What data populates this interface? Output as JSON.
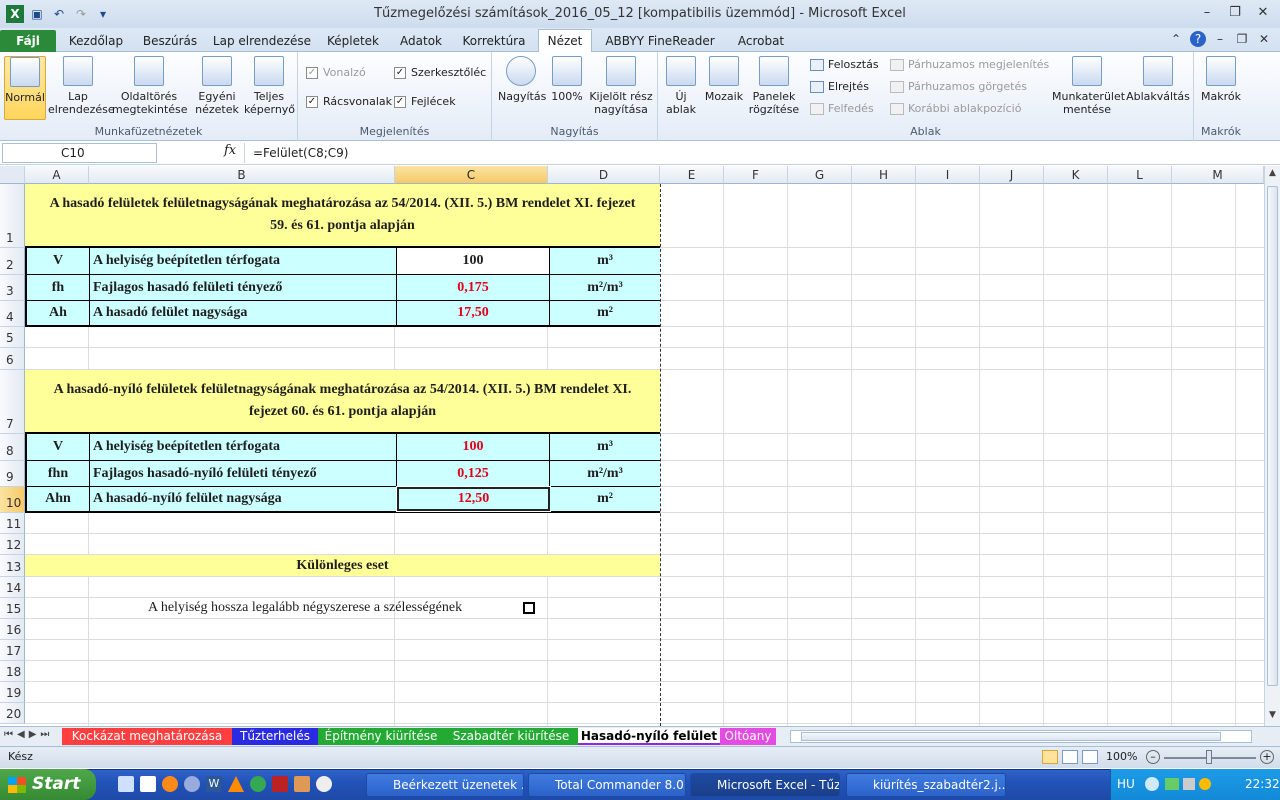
{
  "window": {
    "title": "Tűzmegelőzési számítások_2016_05_12  [kompatibilis üzemmód]  -  Microsoft Excel"
  },
  "ribbon_tabs": [
    "Fájl",
    "Kezdőlap",
    "Beszúrás",
    "Lap elrendezése",
    "Képletek",
    "Adatok",
    "Korrektúra",
    "Nézet",
    "ABBYY FineReader 11",
    "Acrobat"
  ],
  "ribbon": {
    "munkafuzet": {
      "label": "Munkafüzetnézetek",
      "normal": "Normál",
      "lap": "Lap elrendezése",
      "oldaltores": "Oldaltörés megtekintése",
      "egyeni": "Egyéni nézetek",
      "teljes": "Teljes képernyő"
    },
    "megjelenites": {
      "label": "Megjelenítés",
      "vonalzo": "Vonalzó",
      "racsvonalak": "Rácsvonalak",
      "szerkesztoles": "Szerkesztőléc",
      "fejlecek": "Fejlécek"
    },
    "nagyitas": {
      "label": "Nagyítás",
      "nagyitas": "Nagyítás",
      "szaz": "100%",
      "kijelolt": "Kijelölt rész nagyítása"
    },
    "ablak": {
      "label": "Ablak",
      "uj": "Új ablak",
      "mozaik": "Mozaik",
      "panelek": "Panelek rögzítése",
      "felosztas": "Felosztás",
      "elrejtes": "Elrejtés",
      "felfedes": "Felfedés",
      "parhuzamos": "Párhuzamos megjelenítés",
      "gorgetes": "Párhuzamos görgetés",
      "korabbi": "Korábbi ablakpozíció",
      "mentes": "Munkaterület mentése",
      "ablakvaltas": "Ablakváltás"
    },
    "makrok": {
      "label": "Makrók",
      "makrok": "Makrók"
    }
  },
  "formula_bar": {
    "name_box": "C10",
    "fx": "fx",
    "formula": "=Felület(C8;C9)"
  },
  "columns": [
    "A",
    "B",
    "C",
    "D",
    "E",
    "F",
    "G",
    "H",
    "I",
    "J",
    "K",
    "L",
    "M"
  ],
  "rows": [
    "1",
    "2",
    "3",
    "4",
    "5",
    "6",
    "7",
    "8",
    "9",
    "10",
    "11",
    "12",
    "13",
    "14",
    "15",
    "16",
    "17",
    "18",
    "19",
    "20"
  ],
  "sheet": {
    "header1": "A hasadó felületek felületnagyságának meghatározása az 54/2014. (XII. 5.) BM rendelet XI. fejezet 59. és 61. pontja alapján",
    "r2": {
      "sym": "V",
      "desc": "A helyiség beépítetlen térfogata",
      "val": "100",
      "unit": "m³"
    },
    "r3": {
      "sym": "fh",
      "desc": "Fajlagos hasadó felületi tényező",
      "val": "0,175",
      "unit": "m²/m³"
    },
    "r4": {
      "sym": "Ah",
      "desc": "A hasadó felület nagysága",
      "val": "17,50",
      "unit": "m²"
    },
    "header2": "A hasadó-nyíló felületek felületnagyságának meghatározása az 54/2014. (XII. 5.) BM rendelet XI. fejezet 60. és 61. pontja alapján",
    "r8": {
      "sym": "V",
      "desc": "A helyiség beépítetlen térfogata",
      "val": "100",
      "unit": "m³"
    },
    "r9": {
      "sym": "fhn",
      "desc": "Fajlagos hasadó-nyíló felületi tényező",
      "val": "0,125",
      "unit": "m²/m³"
    },
    "r10": {
      "sym": "Ahn",
      "desc": "A hasadó-nyíló felület nagysága",
      "val": "12,50",
      "unit": "m²"
    },
    "special": "Különleges eset",
    "checkbox_label": "A helyiség hossza legalább négyszerese a szélességének"
  },
  "sheet_tabs": [
    "Kockázat meghatározása",
    "Tűzterhelés",
    "Építmény kiürítése",
    "Szabadtér kiürítése",
    "Hasadó-nyíló felület",
    "Oltóany"
  ],
  "status": {
    "ready": "Kész",
    "zoom": "100%"
  },
  "taskbar": {
    "start": "Start",
    "items": [
      "Beérkezett üzenetek ...",
      "Total Commander 8.0...",
      "Microsoft Excel - Tűz...",
      "kiürítés_szabadtér2.j..."
    ],
    "lang": "HU",
    "time": "22:32"
  }
}
